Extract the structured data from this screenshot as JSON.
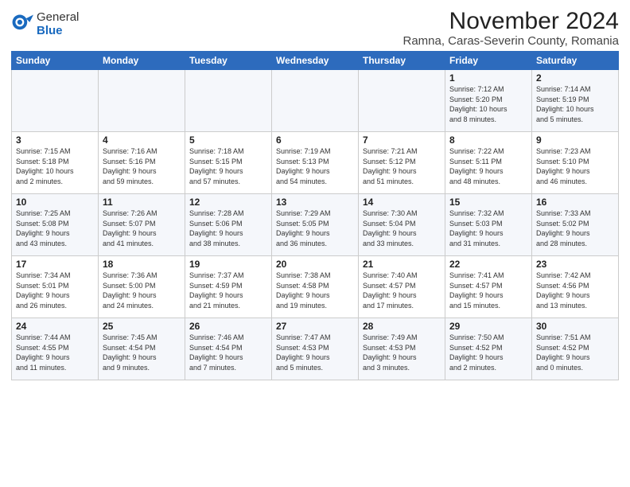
{
  "header": {
    "logo": {
      "general": "General",
      "blue": "Blue"
    },
    "title": "November 2024",
    "location": "Ramna, Caras-Severin County, Romania"
  },
  "weekdays": [
    "Sunday",
    "Monday",
    "Tuesday",
    "Wednesday",
    "Thursday",
    "Friday",
    "Saturday"
  ],
  "weeks": [
    [
      {
        "day": "",
        "info": ""
      },
      {
        "day": "",
        "info": ""
      },
      {
        "day": "",
        "info": ""
      },
      {
        "day": "",
        "info": ""
      },
      {
        "day": "",
        "info": ""
      },
      {
        "day": "1",
        "info": "Sunrise: 7:12 AM\nSunset: 5:20 PM\nDaylight: 10 hours\nand 8 minutes."
      },
      {
        "day": "2",
        "info": "Sunrise: 7:14 AM\nSunset: 5:19 PM\nDaylight: 10 hours\nand 5 minutes."
      }
    ],
    [
      {
        "day": "3",
        "info": "Sunrise: 7:15 AM\nSunset: 5:18 PM\nDaylight: 10 hours\nand 2 minutes."
      },
      {
        "day": "4",
        "info": "Sunrise: 7:16 AM\nSunset: 5:16 PM\nDaylight: 9 hours\nand 59 minutes."
      },
      {
        "day": "5",
        "info": "Sunrise: 7:18 AM\nSunset: 5:15 PM\nDaylight: 9 hours\nand 57 minutes."
      },
      {
        "day": "6",
        "info": "Sunrise: 7:19 AM\nSunset: 5:13 PM\nDaylight: 9 hours\nand 54 minutes."
      },
      {
        "day": "7",
        "info": "Sunrise: 7:21 AM\nSunset: 5:12 PM\nDaylight: 9 hours\nand 51 minutes."
      },
      {
        "day": "8",
        "info": "Sunrise: 7:22 AM\nSunset: 5:11 PM\nDaylight: 9 hours\nand 48 minutes."
      },
      {
        "day": "9",
        "info": "Sunrise: 7:23 AM\nSunset: 5:10 PM\nDaylight: 9 hours\nand 46 minutes."
      }
    ],
    [
      {
        "day": "10",
        "info": "Sunrise: 7:25 AM\nSunset: 5:08 PM\nDaylight: 9 hours\nand 43 minutes."
      },
      {
        "day": "11",
        "info": "Sunrise: 7:26 AM\nSunset: 5:07 PM\nDaylight: 9 hours\nand 41 minutes."
      },
      {
        "day": "12",
        "info": "Sunrise: 7:28 AM\nSunset: 5:06 PM\nDaylight: 9 hours\nand 38 minutes."
      },
      {
        "day": "13",
        "info": "Sunrise: 7:29 AM\nSunset: 5:05 PM\nDaylight: 9 hours\nand 36 minutes."
      },
      {
        "day": "14",
        "info": "Sunrise: 7:30 AM\nSunset: 5:04 PM\nDaylight: 9 hours\nand 33 minutes."
      },
      {
        "day": "15",
        "info": "Sunrise: 7:32 AM\nSunset: 5:03 PM\nDaylight: 9 hours\nand 31 minutes."
      },
      {
        "day": "16",
        "info": "Sunrise: 7:33 AM\nSunset: 5:02 PM\nDaylight: 9 hours\nand 28 minutes."
      }
    ],
    [
      {
        "day": "17",
        "info": "Sunrise: 7:34 AM\nSunset: 5:01 PM\nDaylight: 9 hours\nand 26 minutes."
      },
      {
        "day": "18",
        "info": "Sunrise: 7:36 AM\nSunset: 5:00 PM\nDaylight: 9 hours\nand 24 minutes."
      },
      {
        "day": "19",
        "info": "Sunrise: 7:37 AM\nSunset: 4:59 PM\nDaylight: 9 hours\nand 21 minutes."
      },
      {
        "day": "20",
        "info": "Sunrise: 7:38 AM\nSunset: 4:58 PM\nDaylight: 9 hours\nand 19 minutes."
      },
      {
        "day": "21",
        "info": "Sunrise: 7:40 AM\nSunset: 4:57 PM\nDaylight: 9 hours\nand 17 minutes."
      },
      {
        "day": "22",
        "info": "Sunrise: 7:41 AM\nSunset: 4:57 PM\nDaylight: 9 hours\nand 15 minutes."
      },
      {
        "day": "23",
        "info": "Sunrise: 7:42 AM\nSunset: 4:56 PM\nDaylight: 9 hours\nand 13 minutes."
      }
    ],
    [
      {
        "day": "24",
        "info": "Sunrise: 7:44 AM\nSunset: 4:55 PM\nDaylight: 9 hours\nand 11 minutes."
      },
      {
        "day": "25",
        "info": "Sunrise: 7:45 AM\nSunset: 4:54 PM\nDaylight: 9 hours\nand 9 minutes."
      },
      {
        "day": "26",
        "info": "Sunrise: 7:46 AM\nSunset: 4:54 PM\nDaylight: 9 hours\nand 7 minutes."
      },
      {
        "day": "27",
        "info": "Sunrise: 7:47 AM\nSunset: 4:53 PM\nDaylight: 9 hours\nand 5 minutes."
      },
      {
        "day": "28",
        "info": "Sunrise: 7:49 AM\nSunset: 4:53 PM\nDaylight: 9 hours\nand 3 minutes."
      },
      {
        "day": "29",
        "info": "Sunrise: 7:50 AM\nSunset: 4:52 PM\nDaylight: 9 hours\nand 2 minutes."
      },
      {
        "day": "30",
        "info": "Sunrise: 7:51 AM\nSunset: 4:52 PM\nDaylight: 9 hours\nand 0 minutes."
      }
    ]
  ]
}
